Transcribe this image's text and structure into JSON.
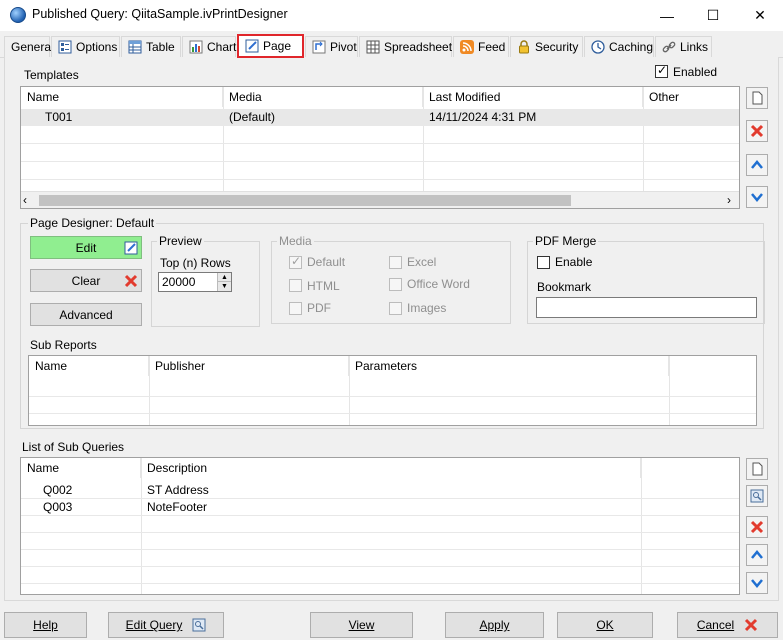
{
  "window": {
    "title": "Published Query: QiitaSample.ivPrintDesigner",
    "minimize": "—",
    "maximize": "☐",
    "close": "✕"
  },
  "tabs": [
    {
      "label": "General",
      "icon": "none"
    },
    {
      "label": "Options",
      "icon": "options-icon"
    },
    {
      "label": "Table",
      "icon": "table-icon"
    },
    {
      "label": "Chart",
      "icon": "chart-icon"
    },
    {
      "label": "Page",
      "icon": "page-icon",
      "active": true
    },
    {
      "label": "Pivot",
      "icon": "pivot-icon"
    },
    {
      "label": "Spreadsheet",
      "icon": "spreadsheet-icon"
    },
    {
      "label": "Feed",
      "icon": "rss-feed-icon"
    },
    {
      "label": "Security",
      "icon": "lock-icon"
    },
    {
      "label": "Caching",
      "icon": "clock-icon"
    },
    {
      "label": "Links",
      "icon": "link-icon"
    }
  ],
  "templates": {
    "label": "Templates",
    "enabled_label": "Enabled",
    "enabled": true,
    "columns": [
      "Name",
      "Media",
      "Last Modified",
      "Other"
    ],
    "rows": [
      {
        "name": "T001",
        "media": "(Default)",
        "modified": "14/11/2024 4:31 PM",
        "other": ""
      }
    ]
  },
  "page_designer": {
    "label": "Page Designer: Default",
    "edit_label": "Edit",
    "clear_label": "Clear",
    "advanced_label": "Advanced",
    "preview": {
      "title": "Preview",
      "rows_label": "Top (n) Rows",
      "rows_value": "20000"
    },
    "media": {
      "title": "Media",
      "options": [
        {
          "label": "Default",
          "checked": true
        },
        {
          "label": "HTML",
          "checked": false
        },
        {
          "label": "PDF",
          "checked": false
        },
        {
          "label": "Excel",
          "checked": false
        },
        {
          "label": "Office Word",
          "checked": false
        },
        {
          "label": "Images",
          "checked": false
        }
      ]
    },
    "pdf_merge": {
      "title": "PDF Merge",
      "enable_label": "Enable",
      "enable": false,
      "bookmark_label": "Bookmark",
      "bookmark_value": ""
    }
  },
  "sub_reports": {
    "label": "Sub Reports",
    "columns": [
      "Name",
      "Publisher",
      "Parameters"
    ]
  },
  "sub_queries": {
    "label": "List of Sub Queries",
    "columns": [
      "Name",
      "Description"
    ],
    "rows": [
      {
        "name": "Q002",
        "description": "ST Address"
      },
      {
        "name": "Q003",
        "description": "NoteFooter"
      }
    ]
  },
  "footer": {
    "help": "Help",
    "edit_query": "Edit Query",
    "view": "View",
    "apply": "Apply",
    "ok": "OK",
    "cancel": "Cancel"
  },
  "colors": {
    "edit_button_bg": "#90ee90",
    "active_tab_border": "#e0262b",
    "delete_red": "#e23b2e",
    "arrow_blue": "#1f6fd1"
  }
}
